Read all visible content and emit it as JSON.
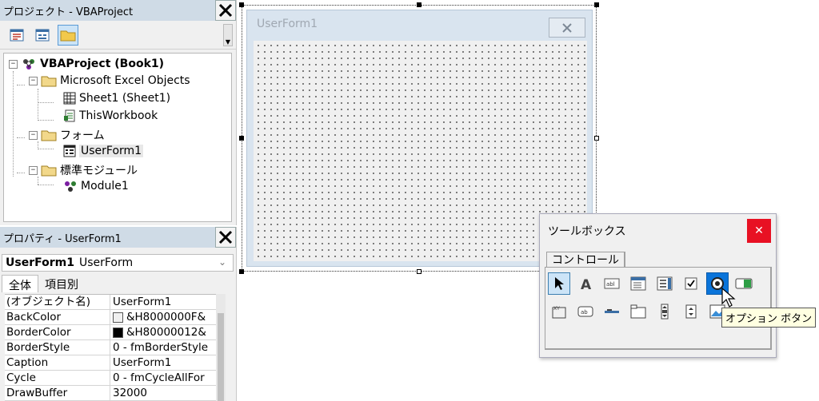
{
  "project": {
    "title": "プロジェクト - VBAProject",
    "tree": {
      "root": "VBAProject (Book1)",
      "excel_objects": "Microsoft Excel Objects",
      "sheet1": "Sheet1 (Sheet1)",
      "thisworkbook": "ThisWorkbook",
      "forms": "フォーム",
      "userform1": "UserForm1",
      "modules": "標準モジュール",
      "module1": "Module1"
    }
  },
  "properties": {
    "title": "プロパティ - UserForm1",
    "object_name": "UserForm1",
    "object_type": "UserForm",
    "tabs": [
      "全体",
      "項目別"
    ],
    "rows": [
      {
        "name": "(オブジェクト名)",
        "value": "UserForm1"
      },
      {
        "name": "BackColor",
        "value": "&H8000000F&",
        "swatch": "#f0f0f0"
      },
      {
        "name": "BorderColor",
        "value": "&H80000012&",
        "swatch": "#000000"
      },
      {
        "name": "BorderStyle",
        "value": "0 - fmBorderStyle"
      },
      {
        "name": "Caption",
        "value": "UserForm1"
      },
      {
        "name": "Cycle",
        "value": "0 - fmCycleAllFor"
      },
      {
        "name": "DrawBuffer",
        "value": "32000"
      }
    ]
  },
  "designer": {
    "form_caption": "UserForm1"
  },
  "toolbox": {
    "title": "ツールボックス",
    "tab": "コントロール",
    "tooltip": "オプション ボタン"
  }
}
